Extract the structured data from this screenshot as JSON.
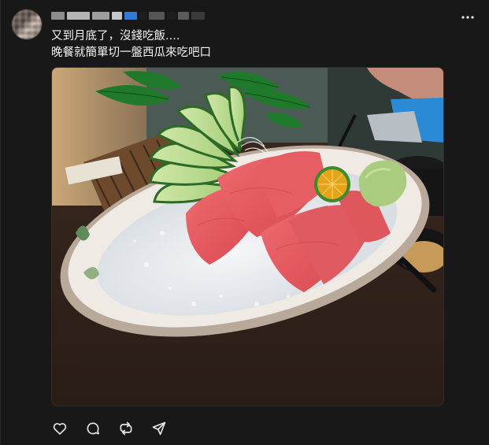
{
  "post": {
    "caption_lines": [
      "又到月底了，沒錢吃飯....",
      "晚餐就簡單切一盤西瓜來吃吧口"
    ],
    "more_icon": "more-horizontal-icon",
    "image_alt_icon": "photo"
  },
  "actions": [
    {
      "name": "like",
      "icon": "heart-icon"
    },
    {
      "name": "reply",
      "icon": "comment-icon"
    },
    {
      "name": "repost",
      "icon": "repost-icon"
    },
    {
      "name": "share",
      "icon": "send-icon"
    }
  ],
  "colors": {
    "background": "#181818",
    "text": "#f3f5f7",
    "icon": "#e6e6e6"
  }
}
